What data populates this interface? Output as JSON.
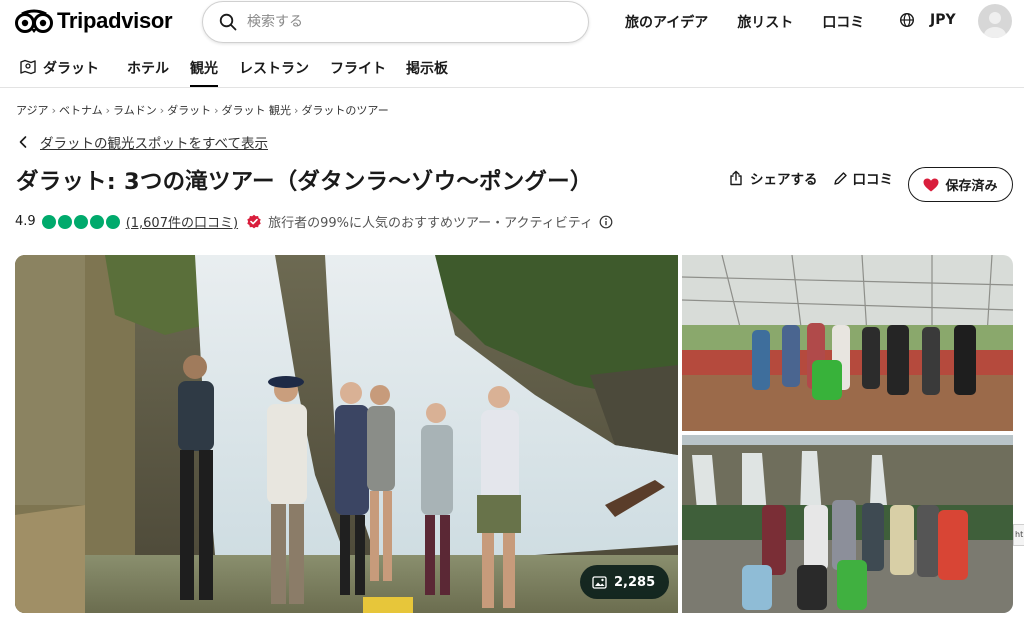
{
  "header": {
    "logo_text": "Tripadvisor",
    "search_placeholder": "検索する",
    "nav": [
      "旅のアイデア",
      "旅リスト",
      "口コミ"
    ],
    "currency": "JPY"
  },
  "subnav": {
    "location": "ダラット",
    "items": [
      "ホテル",
      "観光",
      "レストラン",
      "フライト",
      "掲示板"
    ],
    "active": "観光"
  },
  "breadcrumbs": [
    "アジア",
    "ベトナム",
    "ラムドン",
    "ダラット",
    "ダラット 観光",
    "ダラットのツアー"
  ],
  "back_link": "ダラットの観光スポットをすべて表示",
  "title": "ダラット: 3つの滝ツアー（ダタンラ〜ゾウ〜ポングー）",
  "actions": {
    "share": "シェアする",
    "review": "口コミ",
    "saved": "保存済み"
  },
  "rating": {
    "score": "4.9",
    "bubbles": 5,
    "reviews_link": "(1,607件の口コミ)",
    "badge": "旅行者の99%に人気のおすすめツアー・アクティビティ"
  },
  "photo_count": "2,285",
  "edge_tab": "ht",
  "colors": {
    "brand_green": "#00aa6c",
    "saved_heart": "#d91e3c"
  },
  "icons": [
    "owl-logo-icon",
    "search-icon",
    "globe-icon",
    "map-icon",
    "chevron-left-icon",
    "share-icon",
    "pencil-icon",
    "heart-icon",
    "verified-badge-icon",
    "info-icon",
    "image-icon"
  ]
}
